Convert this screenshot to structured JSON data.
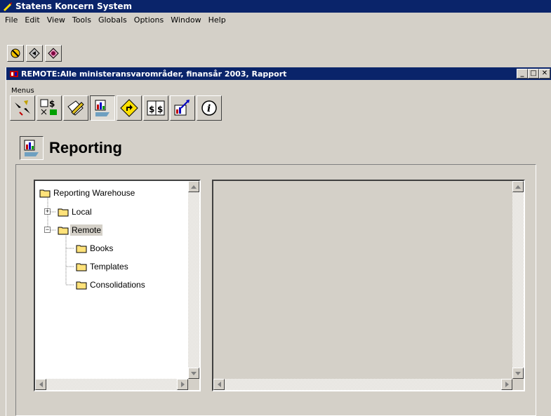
{
  "app": {
    "title": "Statens Koncern System"
  },
  "menubar": {
    "items": [
      "File",
      "Edit",
      "View",
      "Tools",
      "Globals",
      "Options",
      "Window",
      "Help"
    ]
  },
  "child_window": {
    "title": "REMOTE:Alle ministeransvarområder, finansår 2003, Rapport",
    "controls": {
      "minimize": "_",
      "restore": "□",
      "close": "✕"
    }
  },
  "menus_label": "Menus",
  "section": {
    "title": "Reporting"
  },
  "tree": {
    "root": "Reporting Warehouse",
    "local": "Local",
    "remote": "Remote",
    "books": "Books",
    "templates": "Templates",
    "consolidations": "Consolidations",
    "expand_glyph": "+",
    "collapse_glyph": "−"
  },
  "colors": {
    "titlebar": "#0a246a",
    "face": "#d4d0c8",
    "folder": "#ffe27a"
  }
}
